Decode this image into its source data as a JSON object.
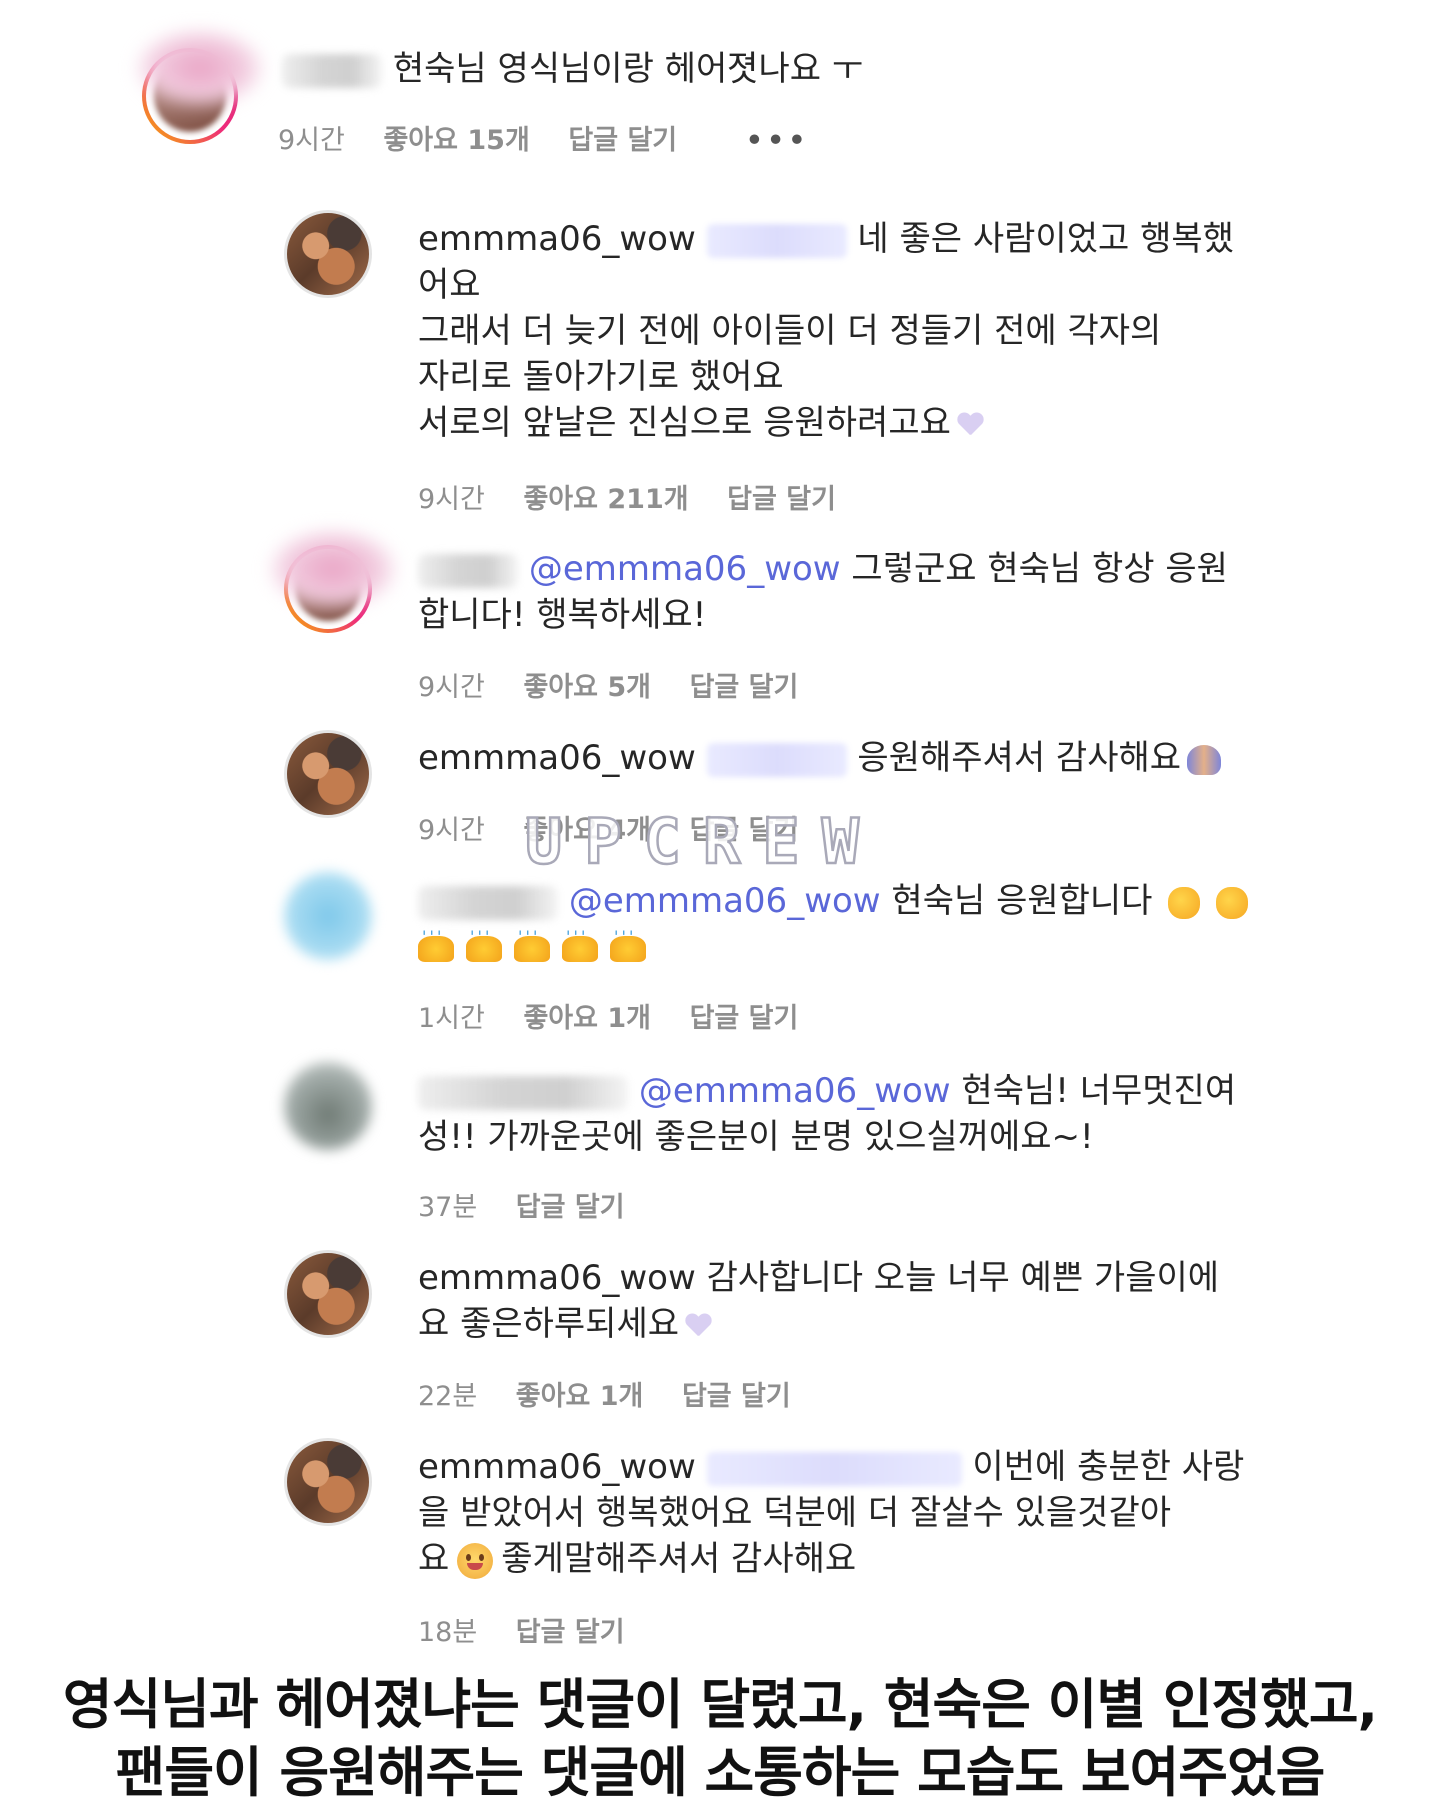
{
  "comments": [
    {
      "body": "현숙님 영식님이랑 헤어졋나요 ㅜ",
      "meta": {
        "time": "9시간",
        "likes": "좋아요 15개",
        "reply": "답글 달기",
        "more": "•••"
      }
    },
    {
      "user": "emmma06_wow",
      "line1": "네 좋은 사람이었고 행복했",
      "line2": "어요",
      "line3": "그래서 더 늦기 전에 아이들이 더 정들기 전에 각자의",
      "line4": "자리로 돌아가기로 했어요",
      "line5": "서로의 앞날은 진심으로 응원하려고요",
      "meta": {
        "time": "9시간",
        "likes": "좋아요 211개",
        "reply": "답글 달기"
      }
    },
    {
      "mention": "@emmma06_wow",
      "line1": " 그렇군요 현숙님 항상 응원",
      "line2": "합니다! 행복하세요!",
      "meta": {
        "time": "9시간",
        "likes": "좋아요 5개",
        "reply": "답글 달기"
      }
    },
    {
      "user": "emmma06_wow",
      "line1": "응원해주셔서 감사해요",
      "meta": {
        "time": "9시간",
        "likes": "좋아요 4개",
        "reply": "답글 달기"
      }
    },
    {
      "mention": "@emmma06_wow",
      "line1": " 현숙님 응원합니다",
      "meta": {
        "time": "1시간",
        "likes": "좋아요 1개",
        "reply": "답글 달기"
      }
    },
    {
      "mention": "@emmma06_wow",
      "line1": " 현숙님! 너무멋진여",
      "line2": "성!! 가까운곳에 좋은분이 분명 있으실꺼에요~!",
      "meta": {
        "time": "37분",
        "reply": "답글 달기"
      }
    },
    {
      "user": "emmma06_wow",
      "line1": " 감사합니다 오늘 너무 예쁜 가을이에",
      "line2": "요 좋은하루되세요",
      "meta": {
        "time": "22분",
        "likes": "좋아요 1개",
        "reply": "답글 달기"
      }
    },
    {
      "user": "emmma06_wow",
      "line1": "이번에 충분한 사랑",
      "line2": "을 받았어서 행복했어요 덕분에 더 잘살수 있을것같아",
      "line3a": "요",
      "line3b": "좋게말해주셔서 감사해요",
      "meta": {
        "time": "18분",
        "reply": "답글 달기"
      }
    }
  ],
  "icons": [
    "purple-heart-icon",
    "folded-hands-icon",
    "clapping-hands-icon",
    "raised-hands-icon",
    "smiling-face-icon"
  ],
  "watermark": "UPCREW",
  "caption": {
    "line1": "영식님과 헤어졌냐는 댓글이 달렸고, 현숙은 이별 인정했고,",
    "line2": "팬들이 응원해주는 댓글에 소통하는 모습도 보여주었음"
  }
}
